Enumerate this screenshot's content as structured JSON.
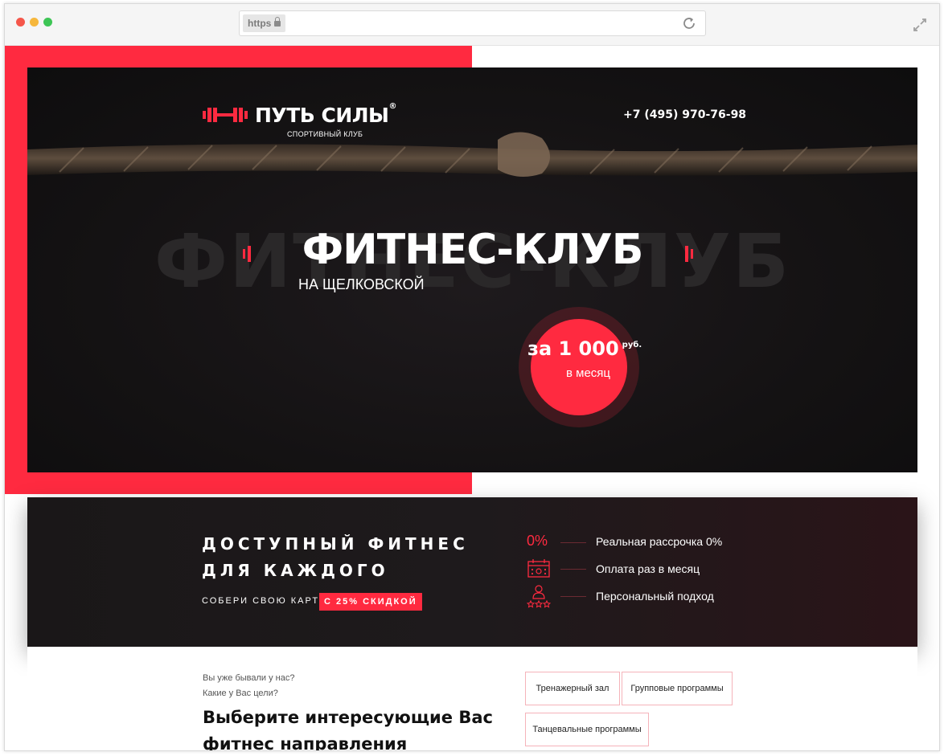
{
  "browser": {
    "protocol_label": "https",
    "icons": [
      "lock-icon",
      "reload-icon",
      "expand-icon"
    ]
  },
  "hero": {
    "logo_text": "ПУТЬ СИЛЫ",
    "logo_reg": "®",
    "logo_sub": "СПОРТИВНЫЙ КЛУБ",
    "phone": "+7 (495) 970-76-98",
    "background_word": "ФИТНЕС-КЛУБ",
    "title": "ФИТНЕС-КЛУБ",
    "subtitle": "НА ЩЕЛКОВСКОЙ",
    "price": "за 1 000",
    "price_unit": "руб.",
    "price_period": "в месяц"
  },
  "band": {
    "title_line1": "ДОСТУПНЫЙ ФИТНЕС",
    "title_line2": "ДЛЯ КАЖДОГО",
    "collect_text": "СОБЕРИ СВОЮ КАРТУ",
    "discount_badge": "С 25% СКИДКОЙ",
    "percent_icon_text": "0%",
    "features": [
      {
        "icon": "percent-icon",
        "text": "Реальная рассрочка 0%"
      },
      {
        "icon": "calendar-icon",
        "text": "Оплата раз в месяц"
      },
      {
        "icon": "person-stars-icon",
        "text": "Персональный подход"
      }
    ]
  },
  "directions": {
    "question1": "Вы уже бывали у нас?",
    "question2": "Какие у Вас цели?",
    "heading_line1": "Выберите интересующие Вас",
    "heading_line2": "фитнес направления",
    "options": [
      "Тренажерный зал",
      "Групповые программы",
      "Танцевальные программы"
    ]
  },
  "colors": {
    "accent": "#ff2a40",
    "hero_bg": "#141213",
    "band_bg": "#1e1a1c"
  }
}
